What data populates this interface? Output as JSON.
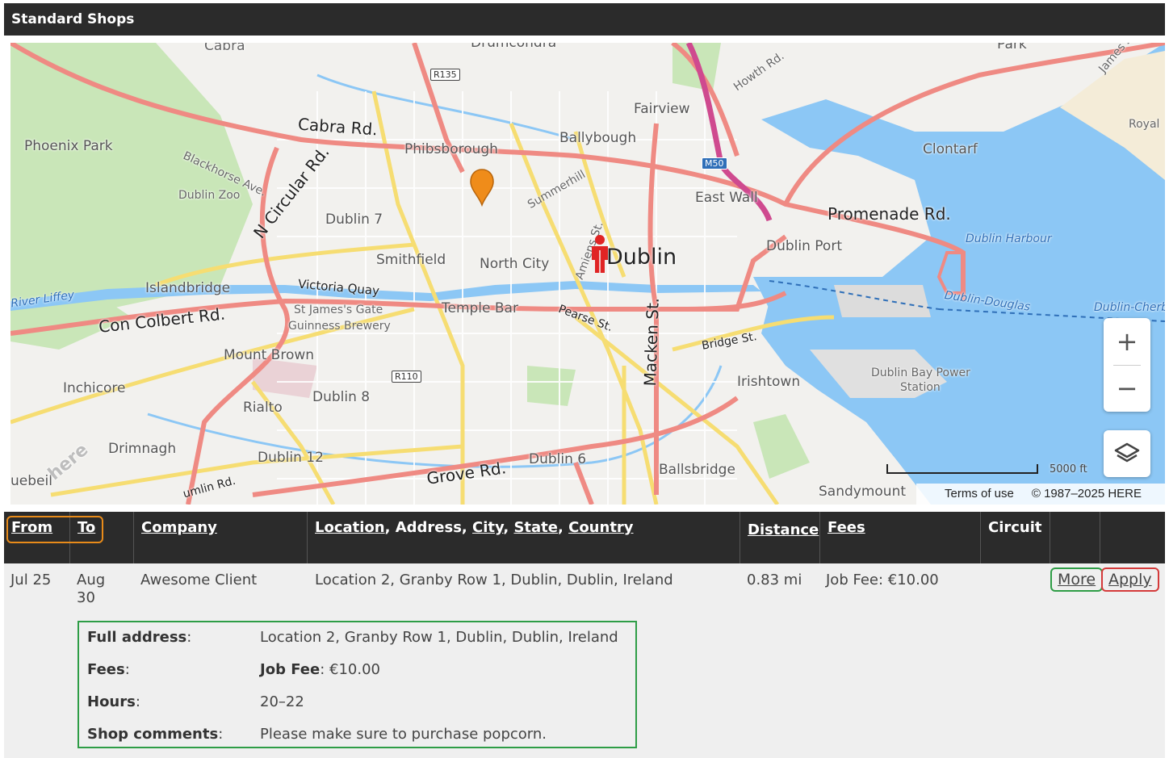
{
  "section_title": "Standard Shops",
  "map": {
    "labels": {
      "cabra": "Cabra",
      "drumcondra": "Drumcondra",
      "park": "Park",
      "phoenix_park": "Phoenix Park",
      "blackhorse": "Blackhorse Ave.",
      "dublin_zoo": "Dublin Zoo",
      "cabra_rd": "Cabra Rd.",
      "phibsborough": "Phibsborough",
      "ballybough": "Ballybough",
      "fairview": "Fairview",
      "howth_rd": "Howth Rd.",
      "james": "James's",
      "royal": "Royal",
      "clontarf": "Clontarf",
      "summerhill": "Summerhill",
      "east_wall": "East Wall",
      "promenade_rd": "Promenade Rd.",
      "n_circular_rd": "N Circular Rd.",
      "dublin7": "Dublin 7",
      "dublin_harbour": "Dublin Harbour",
      "dublin_port": "Dublin Port",
      "smithfield": "Smithfield",
      "north_city": "North City",
      "amiens": "Amiens St.",
      "dublin": "Dublin",
      "islandbridge": "Islandbridge",
      "victoria_quay": "Victoria Quay",
      "liffey": "River Liffey",
      "st_james": "St James's Gate",
      "guinness": "Guinness Brewery",
      "temple_bar": "Temple Bar",
      "pearse": "Pearse St.",
      "dublin_douglas": "Dublin-Douglas",
      "dublin_cherb": "Dublin-Cherb",
      "con_colbert": "Con Colbert Rd.",
      "mount_brown": "Mount Brown",
      "macken": "Macken St.",
      "bridge_st": "Bridge St.",
      "inchicore": "Inchicore",
      "irishtown": "Irishtown",
      "power_station_1": "Dublin Bay Power",
      "power_station_2": "Station",
      "rialto": "Rialto",
      "dublin8": "Dublin 8",
      "drimnagh": "Drimnagh",
      "dublin12": "Dublin 12",
      "dublin6": "Dublin 6",
      "ballsbridge": "Ballsbridge",
      "ballyfermot": "uebeil",
      "crumlin_rd": "umlin Rd.",
      "grove_rd": "Grove Rd.",
      "sandymount": "Sandymount",
      "here_watermark": "here"
    },
    "shields": {
      "r135": "R135",
      "m50": "M50",
      "r110": "R110"
    },
    "zoom_in": "+",
    "zoom_out": "−",
    "scale_label": "5000 ft",
    "terms": "Terms of use",
    "copyright": "© 1987–2025 HERE",
    "icons": {
      "shop_marker": "map-pin-icon",
      "user_location": "person-icon",
      "layers": "layers-icon"
    },
    "colors": {
      "water": "#8cc7f5",
      "park": "#c9e6b8",
      "major_road": "#ef8a83",
      "secondary_road": "#f6dd72",
      "marker": "#ef8c1a",
      "user": "#e02424"
    }
  },
  "table": {
    "headers": {
      "from": "From",
      "to": "To",
      "company": "Company",
      "location": "Location",
      "address_sep": ", Address, ",
      "city": "City",
      "sep1": ", ",
      "state": "State",
      "sep2": ", ",
      "country": "Country",
      "distance": "Distance",
      "fees": "Fees",
      "circuit": "Circuit"
    },
    "row": {
      "from": "Jul 25",
      "to": "Aug 30",
      "company": "Awesome Client",
      "location": "Location 2, Granby Row 1, Dublin, Dublin, Ireland",
      "distance": "0.83 mi",
      "fees": "Job Fee: €10.00",
      "more": "More",
      "apply": "Apply"
    },
    "details": {
      "full_address_label": "Full address",
      "full_address": "Location 2, Granby Row 1, Dublin, Dublin, Ireland",
      "fees_label": "Fees",
      "fees_name": "Job Fee",
      "fees_value": ": €10.00",
      "hours_label": "Hours",
      "hours": "20–22",
      "comments_label": "Shop comments",
      "comments": "Please make sure to purchase popcorn.",
      "colon": ":"
    },
    "highlight_colors": {
      "from_to": "#e88b1a",
      "more": "#2e9d46",
      "apply": "#d43a3a",
      "details": "#2e9d46"
    }
  }
}
